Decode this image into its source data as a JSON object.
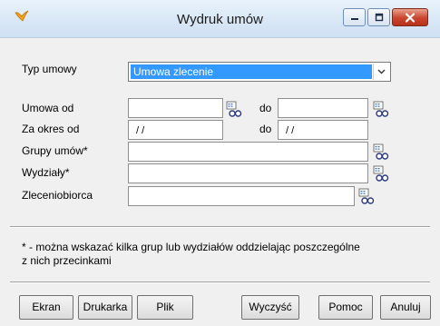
{
  "window": {
    "title": "Wydruk umów"
  },
  "icons": {
    "app": "app-icon",
    "minimize": "minimize-icon",
    "maximize": "maximize-icon",
    "close": "close-icon",
    "dropdown": "chevron-down-icon",
    "picker": "binoculars-icon"
  },
  "form": {
    "typ_umowy": {
      "label": "Typ umowy",
      "value": "Umowa zlecenie"
    },
    "umowa_od": {
      "label": "Umowa od",
      "from_value": "",
      "to_label": "do",
      "to_value": ""
    },
    "za_okres_od": {
      "label": "Za okres od",
      "from_value": "/ /",
      "to_label": "do",
      "to_value": "/ /"
    },
    "grupy_umow": {
      "label": "Grupy umów*",
      "value": ""
    },
    "wydzialy": {
      "label": "Wydziały*",
      "value": ""
    },
    "zleceniobiorca": {
      "label": "Zleceniobiorca",
      "value": ""
    }
  },
  "note": {
    "line1": "* - można wskazać kilka grup lub wydziałów oddzielając poszczególne",
    "line2": "z nich przecinkami"
  },
  "buttons": {
    "ekran": "Ekran",
    "drukarka": "Drukarka",
    "plik": "Plik",
    "wyczysc": "Wyczyść",
    "pomoc": "Pomoc",
    "anuluj": "Anuluj"
  },
  "colors": {
    "selection": "#3399ff",
    "close_button": "#c9452d"
  }
}
